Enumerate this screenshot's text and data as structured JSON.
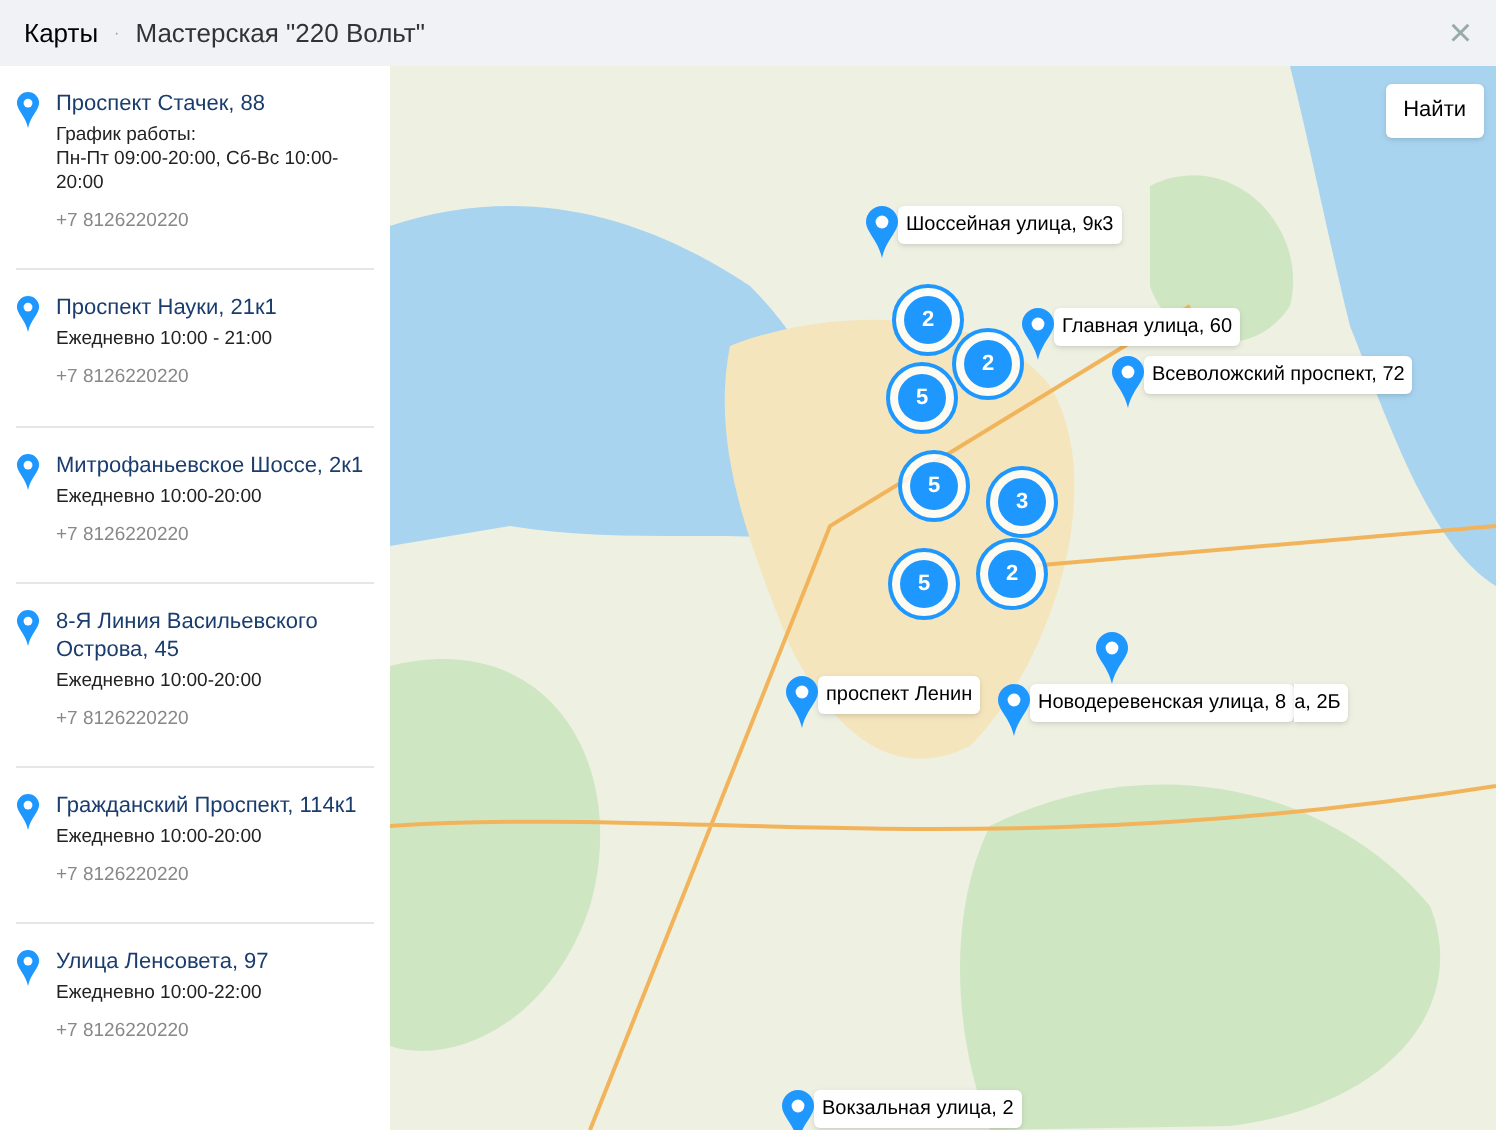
{
  "header": {
    "title": "Карты",
    "separator": "·",
    "subtitle": "Мастерская \"220 Вольт\"",
    "close": "×"
  },
  "locations": [
    {
      "address": "Проспект Стачек, 88",
      "hours": "График работы:\nПн-Пт 09:00-20:00, Сб-Вс 10:00-20:00",
      "phone": "+7 8126220220"
    },
    {
      "address": "Проспект Науки, 21к1",
      "hours": "Ежедневно 10:00 - 21:00",
      "phone": "+7 8126220220"
    },
    {
      "address": "Митрофаньевское Шоссе, 2к1",
      "hours": "Ежедневно 10:00-20:00",
      "phone": "+7 8126220220"
    },
    {
      "address": "8-Я Линия Васильевского Острова, 45",
      "hours": "Ежедневно 10:00-20:00",
      "phone": "+7 8126220220"
    },
    {
      "address": "Гражданский Проспект, 114к1",
      "hours": "Ежедневно 10:00-20:00",
      "phone": "+7 8126220220"
    },
    {
      "address": "Улица Ленсовета, 97",
      "hours": "Ежедневно 10:00-22:00",
      "phone": "+7 8126220220"
    }
  ],
  "map": {
    "find_button": "Найти",
    "markers": [
      {
        "label": "Шоссейная улица, 9к3"
      },
      {
        "label": "Главная улица, 60"
      },
      {
        "label": "Всеволожский проспект, 72"
      },
      {
        "label": "проспект Ленин"
      },
      {
        "label": "Новодеревенская улица, 8"
      },
      {
        "label": "а, 2Б"
      },
      {
        "label": "Вокзальная улица, 2"
      }
    ],
    "clusters": [
      {
        "count": "2"
      },
      {
        "count": "2"
      },
      {
        "count": "5"
      },
      {
        "count": "5"
      },
      {
        "count": "3"
      },
      {
        "count": "2"
      },
      {
        "count": "5"
      }
    ]
  }
}
